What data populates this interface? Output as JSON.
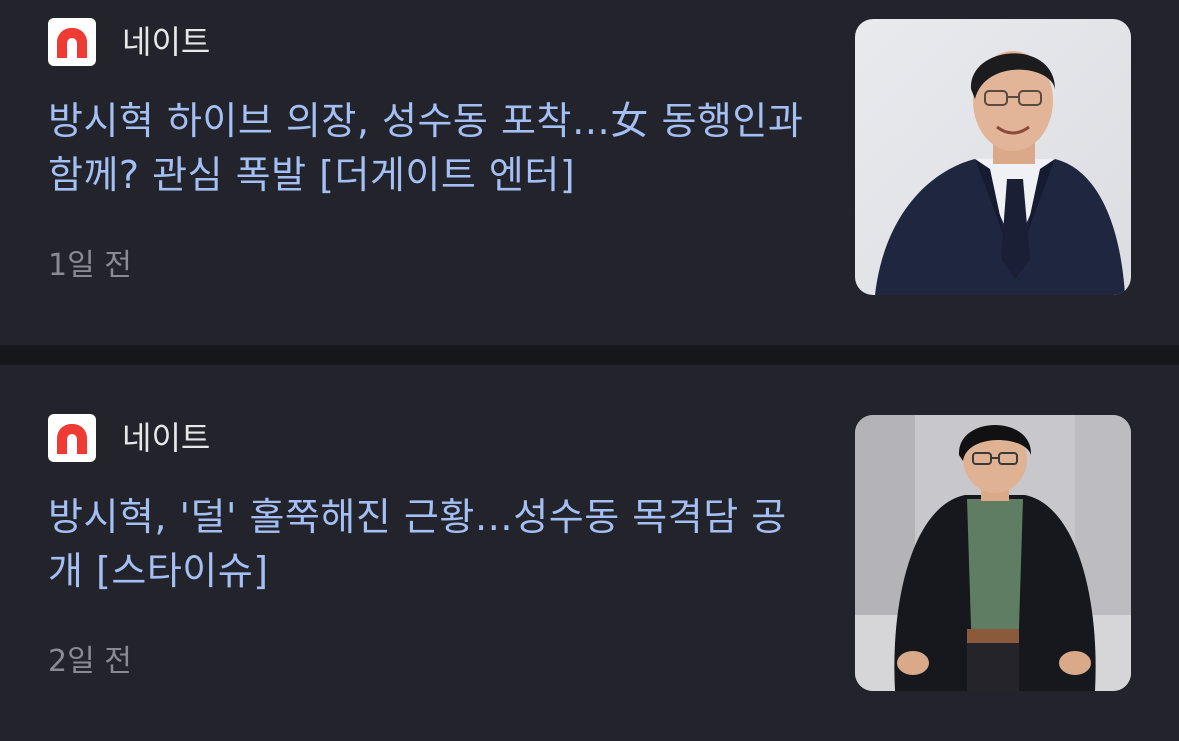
{
  "articles": [
    {
      "source": "네이트",
      "headline": "방시혁 하이브 의장, 성수동 포착…女 동행인과 함께? 관심 폭발 [더게이트 엔터]",
      "time_ago": "1일 전"
    },
    {
      "source": "네이트",
      "headline": "방시혁, '덜' 홀쭉해진 근황…성수동 목격담 공개 [스타이슈]",
      "time_ago": "2일 전"
    }
  ],
  "colors": {
    "background": "#23242b",
    "separator": "#16171a",
    "headline": "#a3bff3",
    "time": "#8a8b92",
    "source": "#e7e7ea",
    "logo_red": "#ee3b33"
  }
}
